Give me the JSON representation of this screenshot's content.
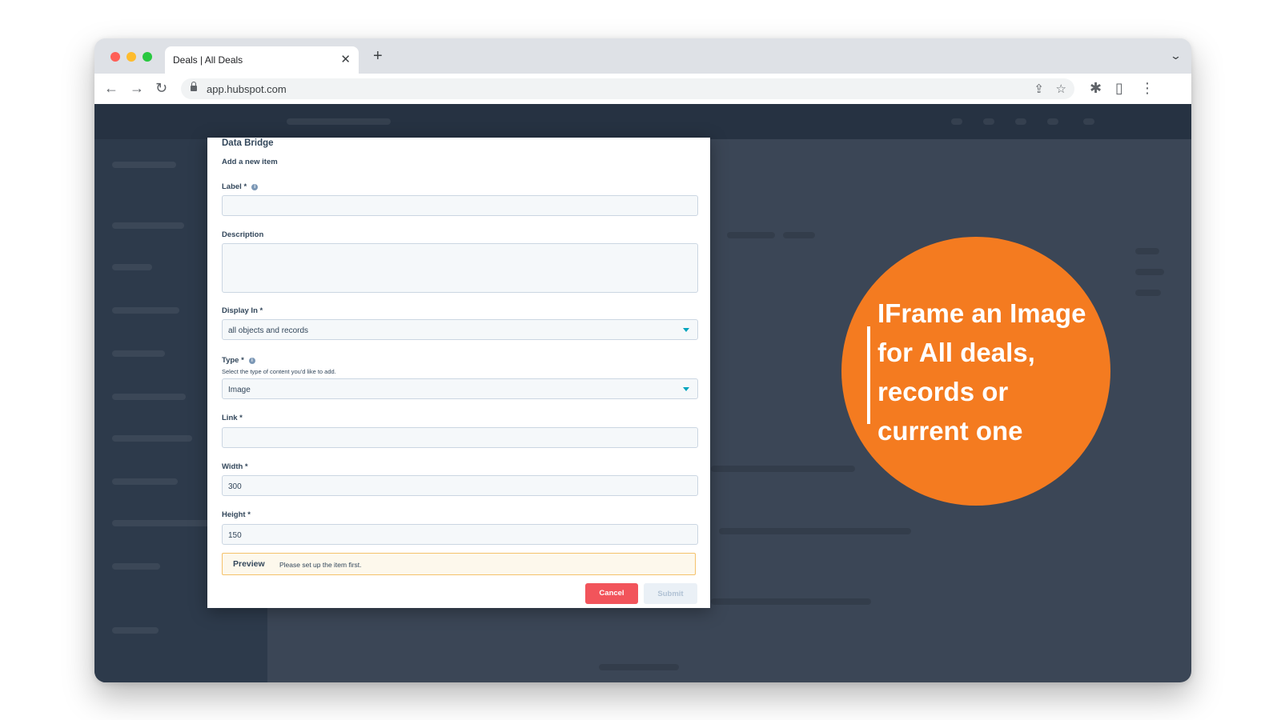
{
  "browser": {
    "tab_title": "Deals | All Deals",
    "tab_close": "✕",
    "new_tab": "+",
    "tabs_menu": "⌄",
    "url": "app.hubspot.com",
    "icons": {
      "back": "←",
      "forward": "→",
      "reload": "↻",
      "share": "⇪",
      "star": "☆",
      "extensions": "✱",
      "sidepanel": "▯",
      "menu": "⋮"
    },
    "traffic_lights": [
      "#ff5f57",
      "#febc2e",
      "#28c840"
    ]
  },
  "modal": {
    "title": "Data Bridge",
    "subtitle": "Add a new item",
    "fields": {
      "label": {
        "label": "Label *",
        "value": ""
      },
      "description": {
        "label": "Description",
        "value": ""
      },
      "display_in": {
        "label": "Display In *",
        "value": "all objects and records"
      },
      "type": {
        "label": "Type *",
        "help": "Select the type of content you'd like to add.",
        "value": "Image"
      },
      "link": {
        "label": "Link *",
        "value": ""
      },
      "width": {
        "label": "Width *",
        "value": "300"
      },
      "height": {
        "label": "Height *",
        "value": "150"
      }
    },
    "info_icon": "i",
    "preview": {
      "title": "Preview",
      "message": "Please set up the item first."
    },
    "buttons": {
      "cancel": "Cancel",
      "submit": "Submit"
    }
  },
  "callout": {
    "lines": [
      "IFrame an Image",
      "for All deals,",
      "records or",
      "current one"
    ],
    "color": "#f47b20"
  },
  "colors": {
    "page_overlay": "#3b4656",
    "accent": "#00a4bd",
    "cancel": "#f2545b"
  }
}
